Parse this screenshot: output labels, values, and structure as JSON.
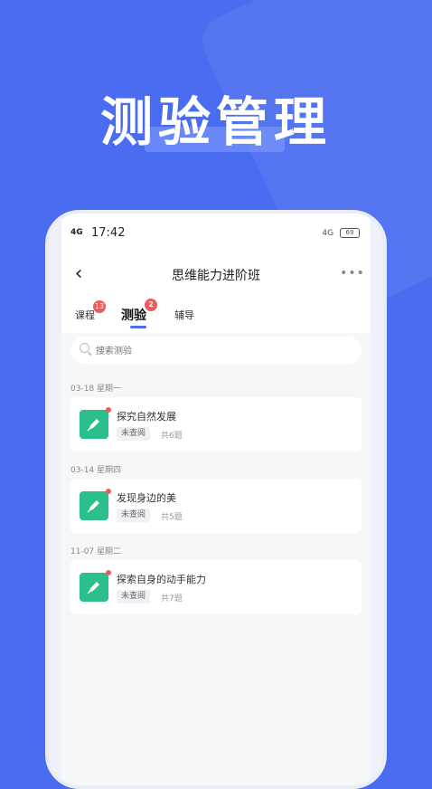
{
  "hero": {
    "title": "测验管理"
  },
  "status_bar": {
    "signal": "4G",
    "time": "17:42",
    "network": "4G",
    "battery": "69"
  },
  "nav": {
    "title": "思维能力进阶班"
  },
  "tabs": [
    {
      "label": "课程",
      "badge": "13"
    },
    {
      "label": "测验",
      "badge": "2"
    },
    {
      "label": "辅导"
    }
  ],
  "search": {
    "placeholder": "搜索测验"
  },
  "groups": [
    {
      "date": "03-18 星期一",
      "title": "探究自然发展",
      "status": "未查阅",
      "count": "共6题"
    },
    {
      "date": "03-14 星期四",
      "title": "发现身边的美",
      "status": "未查阅",
      "count": "共5题"
    },
    {
      "date": "11-07 星期二",
      "title": "探索自身的动手能力",
      "status": "未查阅",
      "count": "共7题"
    }
  ],
  "colors": {
    "brand": "#4a6cf0",
    "icon_bg": "#2bbf8a",
    "badge": "#f05a5a"
  }
}
